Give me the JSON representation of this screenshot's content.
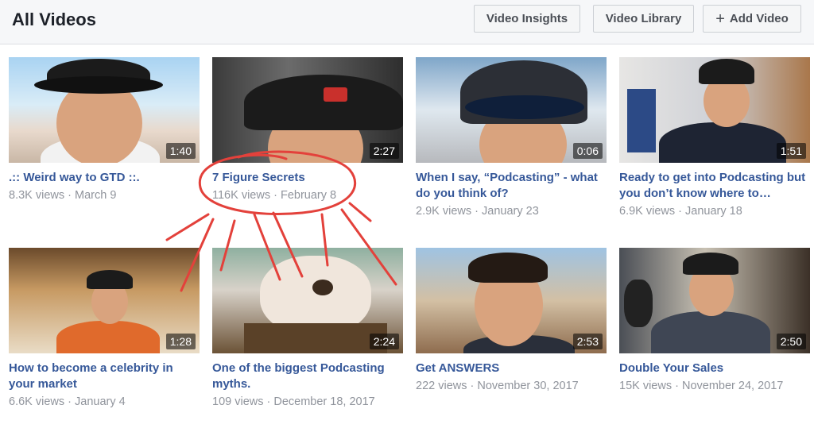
{
  "header": {
    "title": "All Videos",
    "buttons": {
      "insights": "Video Insights",
      "library": "Video Library",
      "add_icon": "+",
      "add": "Add Video"
    }
  },
  "videos": [
    {
      "title": ".:: Weird way to GTD ::.",
      "duration": "1:40",
      "views": "8.3K views",
      "date": "March 9"
    },
    {
      "title": "7 Figure Secrets",
      "duration": "2:27",
      "views": "116K views",
      "date": "February 8"
    },
    {
      "title": "When I say, “Podcasting” - what do you think of?",
      "duration": "0:06",
      "views": "2.9K views",
      "date": "January 23"
    },
    {
      "title": "Ready to get into Podcasting but you don’t know where to…",
      "duration": "1:51",
      "views": "6.9K views",
      "date": "January 18"
    },
    {
      "title": "How to become a celebrity in your market",
      "duration": "1:28",
      "views": "6.6K views",
      "date": "January 4"
    },
    {
      "title": "One of the biggest Podcasting myths.",
      "duration": "2:24",
      "views": "109 views",
      "date": "December 18, 2017"
    },
    {
      "title": "Get ANSWERS",
      "duration": "2:53",
      "views": "222 views",
      "date": "November 30, 2017"
    },
    {
      "title": "Double Your Sales",
      "duration": "2:50",
      "views": "15K views",
      "date": "November 24, 2017"
    }
  ],
  "meta_separator": " · ",
  "colors": {
    "link": "#365899",
    "meta": "#90949c",
    "header_bg": "#f6f7f9",
    "annotation": "#e3413b"
  }
}
